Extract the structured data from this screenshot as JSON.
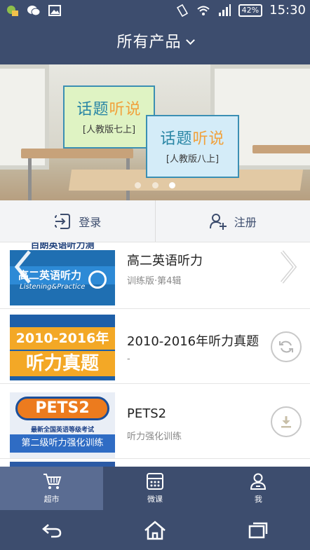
{
  "status_bar": {
    "battery": "42%",
    "time": "15:30"
  },
  "header": {
    "title": "所有产品"
  },
  "banner": {
    "card1": {
      "title_a": "话题",
      "title_b": "听说",
      "subtitle": "[人教版七上]"
    },
    "card2": {
      "title_a": "话题",
      "title_b": "听说",
      "subtitle": "[人教版八上]"
    },
    "slide_count": 3,
    "active_slide": 3
  },
  "auth": {
    "login_label": "登录",
    "register_label": "注册"
  },
  "products": [
    {
      "title": "高二英语听力",
      "subtitle": "训练版·第4辑",
      "thumb_top": "百朗英语听力测",
      "thumb_main": "高二英语听力",
      "thumb_en": "Listening&Practice",
      "action": "none"
    },
    {
      "title": "2010-2016年听力真题",
      "subtitle": "-",
      "thumb_line1": "2010-2016年",
      "thumb_line2": "听力真题",
      "action": "refresh"
    },
    {
      "title": "PETS2",
      "subtitle": "听力强化训练",
      "thumb_badge": "PETS2",
      "thumb_line1": "最新全国英语等级考试",
      "thumb_line2": "第二级听力强化训练",
      "action": "download"
    }
  ],
  "tabs": [
    {
      "label": "超市",
      "icon": "cart-icon",
      "active": true
    },
    {
      "label": "微课",
      "icon": "grid-icon",
      "active": false
    },
    {
      "label": "我",
      "icon": "user-icon",
      "active": false
    }
  ],
  "colors": {
    "primary": "#3d4d6e",
    "tab_active": "#5a6c92",
    "accent_blue": "#2a86a5",
    "accent_orange": "#f1a13b"
  }
}
